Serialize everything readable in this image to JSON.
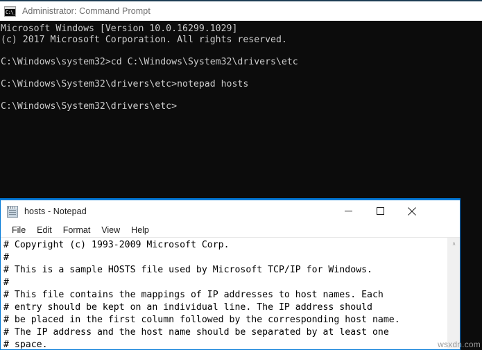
{
  "cmd_window": {
    "icon": "cmd-console-icon",
    "icon_glyph": "C:\\_",
    "title": "Administrator: Command Prompt",
    "console_lines": [
      "Microsoft Windows [Version 10.0.16299.1029]",
      "(c) 2017 Microsoft Corporation. All rights reserved.",
      "",
      "C:\\Windows\\system32>cd C:\\Windows\\System32\\drivers\\etc",
      "",
      "C:\\Windows\\System32\\drivers\\etc>notepad hosts",
      "",
      "C:\\Windows\\System32\\drivers\\etc>"
    ],
    "background_color": "#0c0c0c",
    "text_color": "#cccccc",
    "titlebar_color": "#ffffff"
  },
  "notepad_window": {
    "icon": "notepad-document-icon",
    "title": "hosts - Notepad",
    "accent_color": "#0078d7",
    "controls": {
      "minimize": "—",
      "maximize": "☐",
      "close": "✕"
    },
    "menu": [
      {
        "label": "File"
      },
      {
        "label": "Edit"
      },
      {
        "label": "Format"
      },
      {
        "label": "View"
      },
      {
        "label": "Help"
      }
    ],
    "content_lines": [
      "# Copyright (c) 1993-2009 Microsoft Corp.",
      "#",
      "# This is a sample HOSTS file used by Microsoft TCP/IP for Windows.",
      "#",
      "# This file contains the mappings of IP addresses to host names. Each",
      "# entry should be kept on an individual line. The IP address should",
      "# be placed in the first column followed by the corresponding host name.",
      "# The IP address and the host name should be separated by at least one",
      "# space."
    ],
    "scrollbar": {
      "up_arrow": "∧"
    }
  },
  "watermark": {
    "text": "wsxdn.com"
  }
}
